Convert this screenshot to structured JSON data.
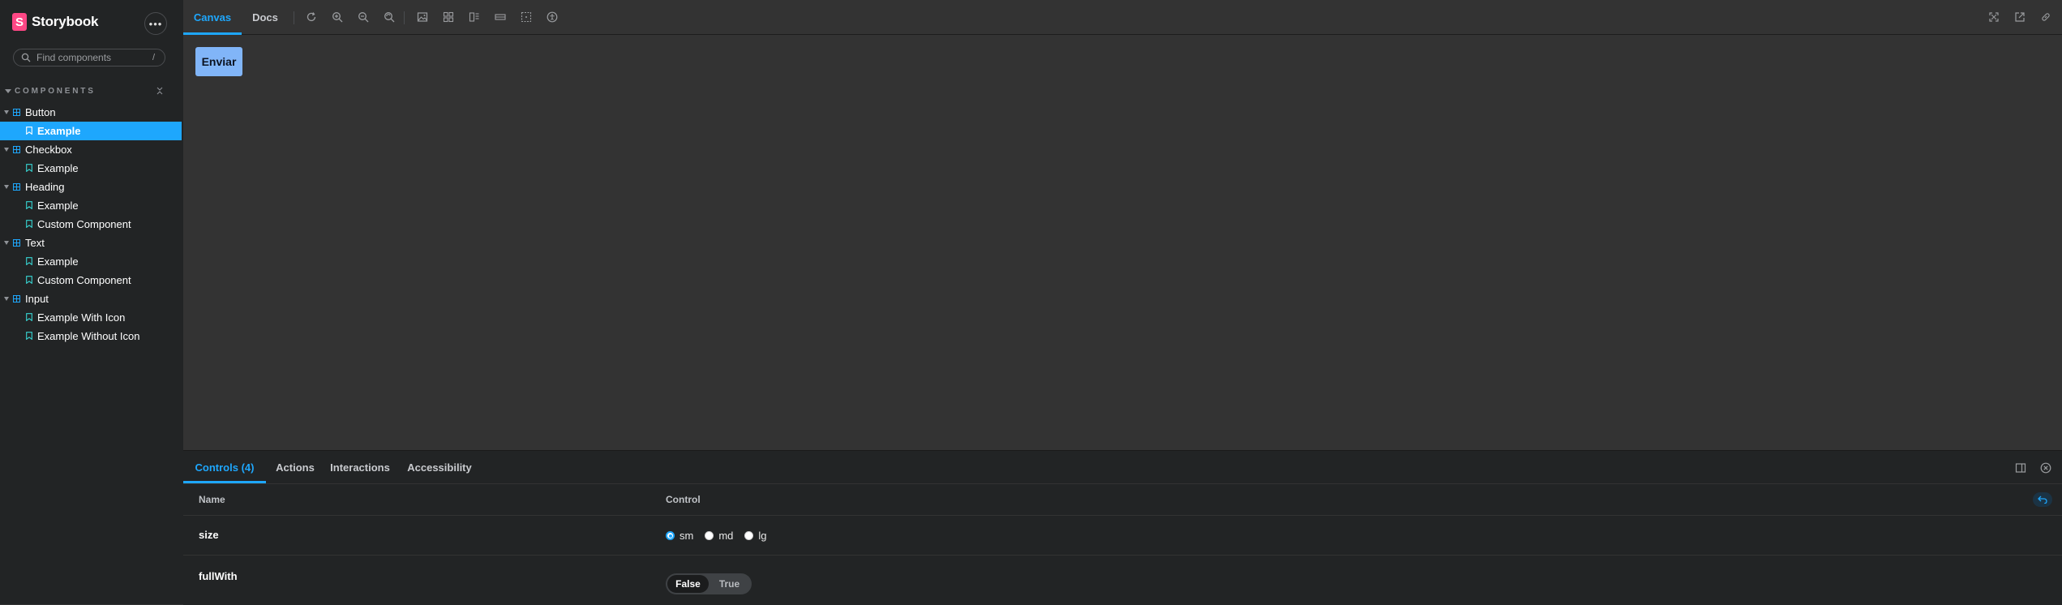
{
  "sidebar": {
    "brand": "Storybook",
    "logo_letter": "S",
    "menu_label": "•••",
    "search": {
      "placeholder": "Find components",
      "shortcut": "/"
    },
    "section_label": "COMPONENTS",
    "tree": [
      {
        "type": "component",
        "label": "Button"
      },
      {
        "type": "story",
        "label": "Example",
        "selected": true
      },
      {
        "type": "component",
        "label": "Checkbox"
      },
      {
        "type": "story",
        "label": "Example"
      },
      {
        "type": "component",
        "label": "Heading"
      },
      {
        "type": "story",
        "label": "Example"
      },
      {
        "type": "story",
        "label": "Custom Component"
      },
      {
        "type": "component",
        "label": "Text"
      },
      {
        "type": "story",
        "label": "Example"
      },
      {
        "type": "story",
        "label": "Custom Component"
      },
      {
        "type": "component",
        "label": "Input"
      },
      {
        "type": "story",
        "label": "Example With Icon"
      },
      {
        "type": "story",
        "label": "Example Without Icon"
      }
    ]
  },
  "toolbar": {
    "tabs": [
      {
        "label": "Canvas",
        "active": true
      },
      {
        "label": "Docs",
        "active": false
      }
    ],
    "tools": [
      "reload-icon",
      "zoom-in-icon",
      "zoom-out-icon",
      "zoom-reset-icon",
      "background-icon",
      "grid-icon",
      "viewport-icon",
      "measure-icon",
      "outline-icon",
      "accessibility-icon"
    ],
    "right_tools": [
      "fullscreen-icon",
      "open-new-tab-icon",
      "copy-link-icon"
    ]
  },
  "canvas": {
    "button_label": "Enviar",
    "button_color": "#81b5f8"
  },
  "panel": {
    "tabs": [
      {
        "label": "Controls (4)",
        "active": true
      },
      {
        "label": "Actions",
        "active": false
      },
      {
        "label": "Interactions",
        "active": false
      },
      {
        "label": "Accessibility",
        "active": false
      }
    ],
    "columns": {
      "name": "Name",
      "control": "Control"
    },
    "rows": {
      "size": {
        "name": "size",
        "options": [
          "sm",
          "md",
          "lg"
        ],
        "selected": "sm"
      },
      "fullWith": {
        "name": "fullWith",
        "options": [
          "False",
          "True"
        ],
        "selected": "False"
      }
    }
  },
  "colors": {
    "accent": "#1ea7fd",
    "brand": "#ff4785",
    "sidebar_bg": "#222425",
    "canvas_bg": "#333333"
  }
}
